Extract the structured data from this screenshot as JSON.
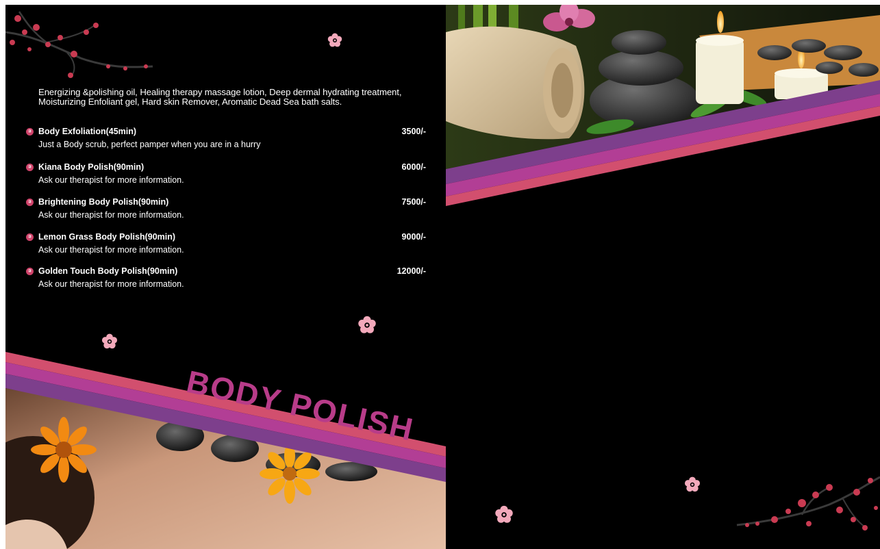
{
  "left_page": {
    "intro": "Energizing &polishing oil, Healing therapy massage lotion, Deep dermal hydrating treatment, Moisturizing Enfoliant gel, Hard skin Remover, Aromatic Dead Sea bath salts.",
    "items": [
      {
        "name": "Body Exfoliation(45min)",
        "price": "3500/-",
        "desc": "Just a Body scrub, perfect pamper when you are in a hurry"
      },
      {
        "name": "Kiana Body Polish(90min)",
        "price": "6000/-",
        "desc": "Ask our therapist for more information."
      },
      {
        "name": "Brightening Body Polish(90min)",
        "price": "7500/-",
        "desc": "Ask our therapist for more information."
      },
      {
        "name": "Lemon Grass Body Polish(90min)",
        "price": "9000/-",
        "desc": "Ask our therapist for more information."
      },
      {
        "name": "Golden Touch Body Polish(90min)",
        "price": "12000/-",
        "desc": "Ask our therapist for more information."
      }
    ],
    "bullet_glyph": "②",
    "heading": "BODY POLISH"
  },
  "colors": {
    "background": "#000000",
    "stripe_pink": "#d24f6e",
    "stripe_magenta": "#b23e95",
    "stripe_purple": "#7d3f8c",
    "heading": "#b83c89",
    "flower": "#f3a9bb"
  },
  "icons": [
    "cherry-blossom-branch-icon",
    "blossom-icon",
    "bullet-icon"
  ]
}
